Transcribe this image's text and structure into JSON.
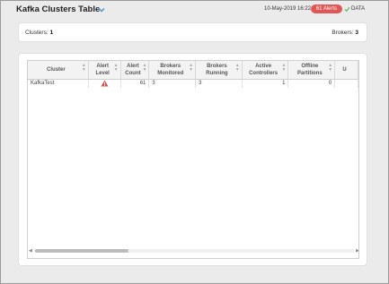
{
  "header": {
    "title": "Kafka Clusters Table",
    "timestamp": "10-May-2019 16:22",
    "alerts_badge": "61 Alerts",
    "data_label": "DATA"
  },
  "summary": {
    "clusters_label": "Clusters:",
    "clusters_value": "1",
    "brokers_label": "Brokers:",
    "brokers_value": "3"
  },
  "table": {
    "columns": [
      [
        "Cluster"
      ],
      [
        "Alert",
        "Level"
      ],
      [
        "Alert",
        "Count"
      ],
      [
        "Brokers",
        "Monitored"
      ],
      [
        "Brokers",
        "Running"
      ],
      [
        "Active",
        "Controllers"
      ],
      [
        "Offline",
        "Partitions"
      ],
      [
        "U"
      ]
    ],
    "rows": [
      {
        "cluster": "KafkaTest",
        "alert_level_icon": "warning-triangle-icon",
        "alert_count": "61",
        "brokers_monitored": "3",
        "brokers_running": "3",
        "active_controllers": "1",
        "offline_partitions": "0"
      }
    ]
  },
  "colors": {
    "alert_badge": "#e05757",
    "warning_icon": "#d9534f",
    "data_check": "#5cb85c",
    "chevron": "#4a90c8"
  }
}
